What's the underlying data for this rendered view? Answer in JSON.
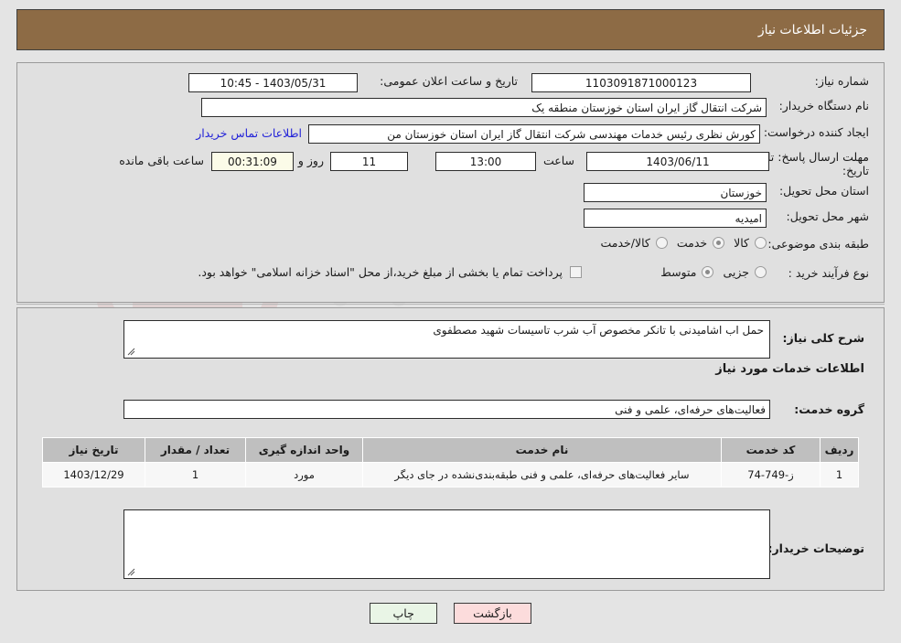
{
  "header": {
    "title": "جزئیات اطلاعات نیاز"
  },
  "form": {
    "need_number_label": "شماره نیاز:",
    "need_number_value": "1103091871000123",
    "announce_label": "تاریخ و ساعت اعلان عمومی:",
    "announce_value": "1403/05/31 - 10:45",
    "buyer_org_label": "نام دستگاه خریدار:",
    "buyer_org_value": "شرکت انتقال گاز ایران  استان خوزستان منطقه یک",
    "creator_label": "ایجاد کننده درخواست:",
    "creator_value": "کورش نظری رئیس خدمات مهندسی شرکت انتقال گاز ایران  استان خوزستان من",
    "contact_link": "اطلاعات تماس خریدار",
    "deadline_label_line1": "مهلت ارسال پاسخ: تا",
    "deadline_label_line2": "تاریخ:",
    "deadline_date": "1403/06/11",
    "hour_label": "ساعت",
    "hour_value": "13:00",
    "days_value": "11",
    "days_label": "روز و",
    "countdown_value": "00:31:09",
    "countdown_label": "ساعت باقی مانده",
    "province_label": "استان محل تحویل:",
    "province_value": "خوزستان",
    "city_label": "شهر محل تحویل:",
    "city_value": "امیدیه",
    "category_label": "طبقه بندی موضوعی:",
    "category_options": [
      {
        "label": "کالا",
        "selected": false
      },
      {
        "label": "خدمت",
        "selected": true
      },
      {
        "label": "کالا/خدمت",
        "selected": false
      }
    ],
    "process_label": "نوع فرآیند خرید :",
    "process_options": [
      {
        "label": "جزیی",
        "selected": false
      },
      {
        "label": "متوسط",
        "selected": true
      }
    ],
    "treasury_checkbox_text": "پرداخت تمام یا بخشی از مبلغ خرید،از محل \"اسناد خزانه اسلامی\" خواهد بود.",
    "treasury_checked": false
  },
  "description": {
    "label": "شرح کلی نیاز:",
    "value": "حمل اب اشامیدنی با تانکر مخصوص آب شرب تاسیسات شهید مصطفوی"
  },
  "services_section": {
    "heading": "اطلاعات خدمات مورد نیاز",
    "group_label": "گروه خدمت:",
    "group_value": "فعالیت‌های حرفه‌ای، علمی و فنی"
  },
  "table": {
    "columns": [
      "ردیف",
      "کد خدمت",
      "نام خدمت",
      "واحد اندازه گیری",
      "تعداد / مقدار",
      "تاریخ نیاز"
    ],
    "rows": [
      {
        "row_no": "1",
        "service_code": "ز-749-74",
        "service_name": "سایر فعالیت‌های حرفه‌ای، علمی و فنی طبقه‌بندی‌نشده در جای دیگر",
        "unit": "مورد",
        "quantity": "1",
        "need_date": "1403/12/29"
      }
    ]
  },
  "buyer_notes": {
    "label": "توضیحات خریدار:",
    "value": ""
  },
  "buttons": {
    "print": "چاپ",
    "back": "بازگشت"
  },
  "watermark": {
    "text": "AriaTender.net"
  },
  "colors": {
    "header_bg": "#8d6b45",
    "page_bg": "#e4e4e4",
    "panel_bg": "#e0e0e0",
    "link": "#2323d8",
    "timer_bg": "#fbfbe8",
    "table_header_bg": "#bfbfbf",
    "print_btn_bg": "#e9f5e6",
    "back_btn_bg": "#fcdcdc"
  }
}
